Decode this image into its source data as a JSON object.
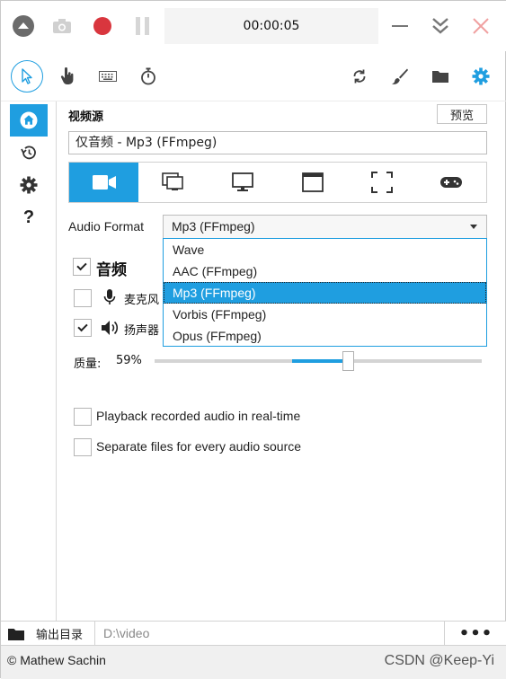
{
  "titlebar": {
    "timer": "00:00:05",
    "colors": {
      "record": "#d9363e",
      "close": "#f0a0a0"
    }
  },
  "toolbar": {
    "icons": [
      "cursor-icon",
      "hand-icon",
      "keyboard-icon",
      "stopwatch-icon",
      "refresh-icon",
      "brush-icon",
      "folder-icon",
      "gear-icon"
    ]
  },
  "sidebar": {
    "items": [
      {
        "icon": "home-icon"
      },
      {
        "icon": "history-icon"
      },
      {
        "icon": "gear-icon"
      },
      {
        "icon": "help-icon",
        "glyph": "?"
      }
    ]
  },
  "video_source": {
    "title": "视频源",
    "preview_label": "预览",
    "current_value": "仅音频 - Mp3 (FFmpeg)",
    "source_icons": [
      "camera-icon",
      "windows-icon",
      "monitor-icon",
      "window-icon",
      "region-icon",
      "gamepad-icon"
    ]
  },
  "audio_format": {
    "label": "Audio Format",
    "selected": "Mp3 (FFmpeg)",
    "options": [
      "Wave",
      "AAC (FFmpeg)",
      "Mp3 (FFmpeg)",
      "Vorbis (FFmpeg)",
      "Opus (FFmpeg)"
    ]
  },
  "audio": {
    "label": "音频",
    "checked": true,
    "mic_label": "麦克风",
    "mic_checked": false,
    "speaker_label": "扬声器",
    "speaker_checked": true
  },
  "quality": {
    "label": "质量:",
    "value_text": "59%",
    "value": 0.59
  },
  "options": {
    "playback_label": "Playback recorded audio in real-time",
    "separate_label": "Separate files for every audio source"
  },
  "output": {
    "button_label": "输出目录",
    "path": "D:\\video",
    "more_label": "•••"
  },
  "footer": {
    "credit": "© Mathew Sachin",
    "watermark": "CSDN @Keep-Yi"
  },
  "accent": "#1f9ee0"
}
